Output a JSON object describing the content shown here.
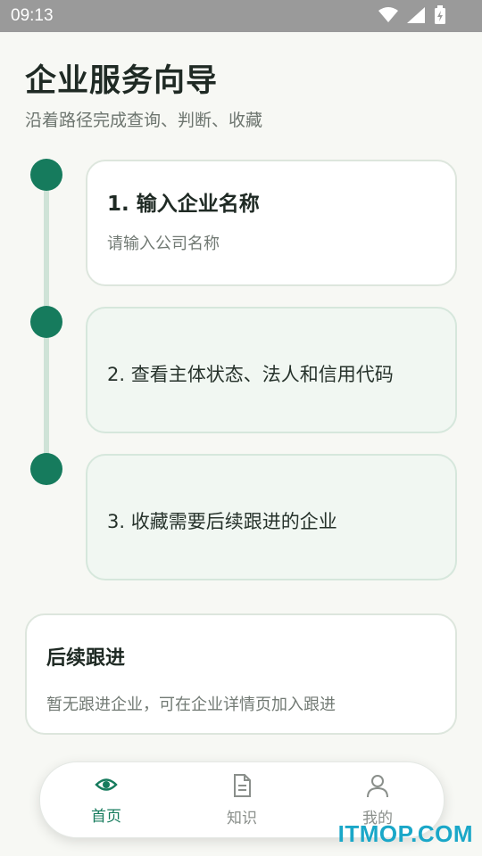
{
  "status_bar": {
    "time": "09:13"
  },
  "header": {
    "title": "企业服务向导",
    "subtitle": "沿着路径完成查询、判断、收藏"
  },
  "steps": [
    {
      "title": "1. 输入企业名称",
      "placeholder": "请输入公司名称"
    },
    {
      "text": "2. 查看主体状态、法人和信用代码"
    },
    {
      "text": "3. 收藏需要后续跟进的企业"
    }
  ],
  "follow_up": {
    "title": "后续跟进",
    "empty_text": "暂无跟进企业，可在企业详情页加入跟进"
  },
  "tabs": [
    {
      "label": "首页",
      "icon": "eye-icon",
      "active": true
    },
    {
      "label": "知识",
      "icon": "document-icon",
      "active": false
    },
    {
      "label": "我的",
      "icon": "person-icon",
      "active": false
    }
  ],
  "watermark": "ITMOP.COM",
  "colors": {
    "accent": "#167b5d",
    "timeline": "#cfe3d7",
    "card_tint": "#f1f7f2",
    "background": "#f7f8f4"
  }
}
